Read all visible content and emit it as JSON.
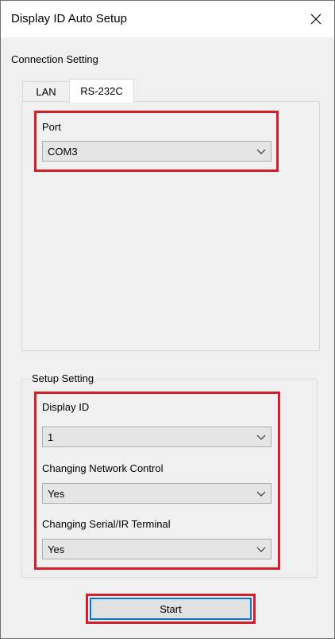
{
  "window": {
    "title": "Display ID Auto Setup",
    "close_icon": "close-icon"
  },
  "connection": {
    "section_label": "Connection Setting",
    "tabs": [
      {
        "label": "LAN",
        "selected": false
      },
      {
        "label": "RS-232C",
        "selected": true
      }
    ],
    "port": {
      "label": "Port",
      "value": "COM3"
    }
  },
  "setup": {
    "group_label": "Setup Setting",
    "display_id": {
      "label": "Display ID",
      "value": "1"
    },
    "network_control": {
      "label": "Changing Network Control",
      "value": "Yes"
    },
    "serial_ir": {
      "label": "Changing Serial/IR Terminal",
      "value": "Yes"
    }
  },
  "actions": {
    "start_label": "Start"
  },
  "colors": {
    "highlight": "#d1202b",
    "focus": "#0078d7"
  }
}
